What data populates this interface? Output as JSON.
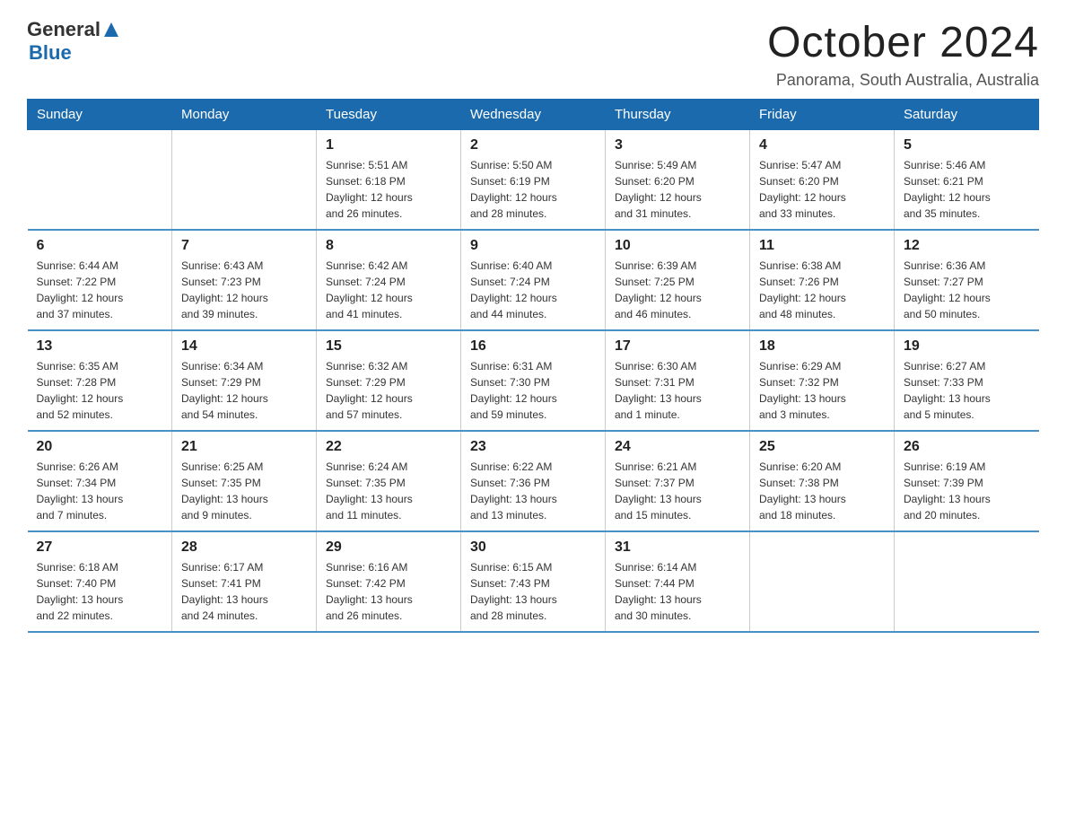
{
  "logo": {
    "text_general": "General",
    "text_blue": "Blue"
  },
  "header": {
    "month_title": "October 2024",
    "location": "Panorama, South Australia, Australia"
  },
  "days_of_week": [
    "Sunday",
    "Monday",
    "Tuesday",
    "Wednesday",
    "Thursday",
    "Friday",
    "Saturday"
  ],
  "weeks": [
    [
      {
        "day": "",
        "info": ""
      },
      {
        "day": "",
        "info": ""
      },
      {
        "day": "1",
        "info": "Sunrise: 5:51 AM\nSunset: 6:18 PM\nDaylight: 12 hours\nand 26 minutes."
      },
      {
        "day": "2",
        "info": "Sunrise: 5:50 AM\nSunset: 6:19 PM\nDaylight: 12 hours\nand 28 minutes."
      },
      {
        "day": "3",
        "info": "Sunrise: 5:49 AM\nSunset: 6:20 PM\nDaylight: 12 hours\nand 31 minutes."
      },
      {
        "day": "4",
        "info": "Sunrise: 5:47 AM\nSunset: 6:20 PM\nDaylight: 12 hours\nand 33 minutes."
      },
      {
        "day": "5",
        "info": "Sunrise: 5:46 AM\nSunset: 6:21 PM\nDaylight: 12 hours\nand 35 minutes."
      }
    ],
    [
      {
        "day": "6",
        "info": "Sunrise: 6:44 AM\nSunset: 7:22 PM\nDaylight: 12 hours\nand 37 minutes."
      },
      {
        "day": "7",
        "info": "Sunrise: 6:43 AM\nSunset: 7:23 PM\nDaylight: 12 hours\nand 39 minutes."
      },
      {
        "day": "8",
        "info": "Sunrise: 6:42 AM\nSunset: 7:24 PM\nDaylight: 12 hours\nand 41 minutes."
      },
      {
        "day": "9",
        "info": "Sunrise: 6:40 AM\nSunset: 7:24 PM\nDaylight: 12 hours\nand 44 minutes."
      },
      {
        "day": "10",
        "info": "Sunrise: 6:39 AM\nSunset: 7:25 PM\nDaylight: 12 hours\nand 46 minutes."
      },
      {
        "day": "11",
        "info": "Sunrise: 6:38 AM\nSunset: 7:26 PM\nDaylight: 12 hours\nand 48 minutes."
      },
      {
        "day": "12",
        "info": "Sunrise: 6:36 AM\nSunset: 7:27 PM\nDaylight: 12 hours\nand 50 minutes."
      }
    ],
    [
      {
        "day": "13",
        "info": "Sunrise: 6:35 AM\nSunset: 7:28 PM\nDaylight: 12 hours\nand 52 minutes."
      },
      {
        "day": "14",
        "info": "Sunrise: 6:34 AM\nSunset: 7:29 PM\nDaylight: 12 hours\nand 54 minutes."
      },
      {
        "day": "15",
        "info": "Sunrise: 6:32 AM\nSunset: 7:29 PM\nDaylight: 12 hours\nand 57 minutes."
      },
      {
        "day": "16",
        "info": "Sunrise: 6:31 AM\nSunset: 7:30 PM\nDaylight: 12 hours\nand 59 minutes."
      },
      {
        "day": "17",
        "info": "Sunrise: 6:30 AM\nSunset: 7:31 PM\nDaylight: 13 hours\nand 1 minute."
      },
      {
        "day": "18",
        "info": "Sunrise: 6:29 AM\nSunset: 7:32 PM\nDaylight: 13 hours\nand 3 minutes."
      },
      {
        "day": "19",
        "info": "Sunrise: 6:27 AM\nSunset: 7:33 PM\nDaylight: 13 hours\nand 5 minutes."
      }
    ],
    [
      {
        "day": "20",
        "info": "Sunrise: 6:26 AM\nSunset: 7:34 PM\nDaylight: 13 hours\nand 7 minutes."
      },
      {
        "day": "21",
        "info": "Sunrise: 6:25 AM\nSunset: 7:35 PM\nDaylight: 13 hours\nand 9 minutes."
      },
      {
        "day": "22",
        "info": "Sunrise: 6:24 AM\nSunset: 7:35 PM\nDaylight: 13 hours\nand 11 minutes."
      },
      {
        "day": "23",
        "info": "Sunrise: 6:22 AM\nSunset: 7:36 PM\nDaylight: 13 hours\nand 13 minutes."
      },
      {
        "day": "24",
        "info": "Sunrise: 6:21 AM\nSunset: 7:37 PM\nDaylight: 13 hours\nand 15 minutes."
      },
      {
        "day": "25",
        "info": "Sunrise: 6:20 AM\nSunset: 7:38 PM\nDaylight: 13 hours\nand 18 minutes."
      },
      {
        "day": "26",
        "info": "Sunrise: 6:19 AM\nSunset: 7:39 PM\nDaylight: 13 hours\nand 20 minutes."
      }
    ],
    [
      {
        "day": "27",
        "info": "Sunrise: 6:18 AM\nSunset: 7:40 PM\nDaylight: 13 hours\nand 22 minutes."
      },
      {
        "day": "28",
        "info": "Sunrise: 6:17 AM\nSunset: 7:41 PM\nDaylight: 13 hours\nand 24 minutes."
      },
      {
        "day": "29",
        "info": "Sunrise: 6:16 AM\nSunset: 7:42 PM\nDaylight: 13 hours\nand 26 minutes."
      },
      {
        "day": "30",
        "info": "Sunrise: 6:15 AM\nSunset: 7:43 PM\nDaylight: 13 hours\nand 28 minutes."
      },
      {
        "day": "31",
        "info": "Sunrise: 6:14 AM\nSunset: 7:44 PM\nDaylight: 13 hours\nand 30 minutes."
      },
      {
        "day": "",
        "info": ""
      },
      {
        "day": "",
        "info": ""
      }
    ]
  ]
}
